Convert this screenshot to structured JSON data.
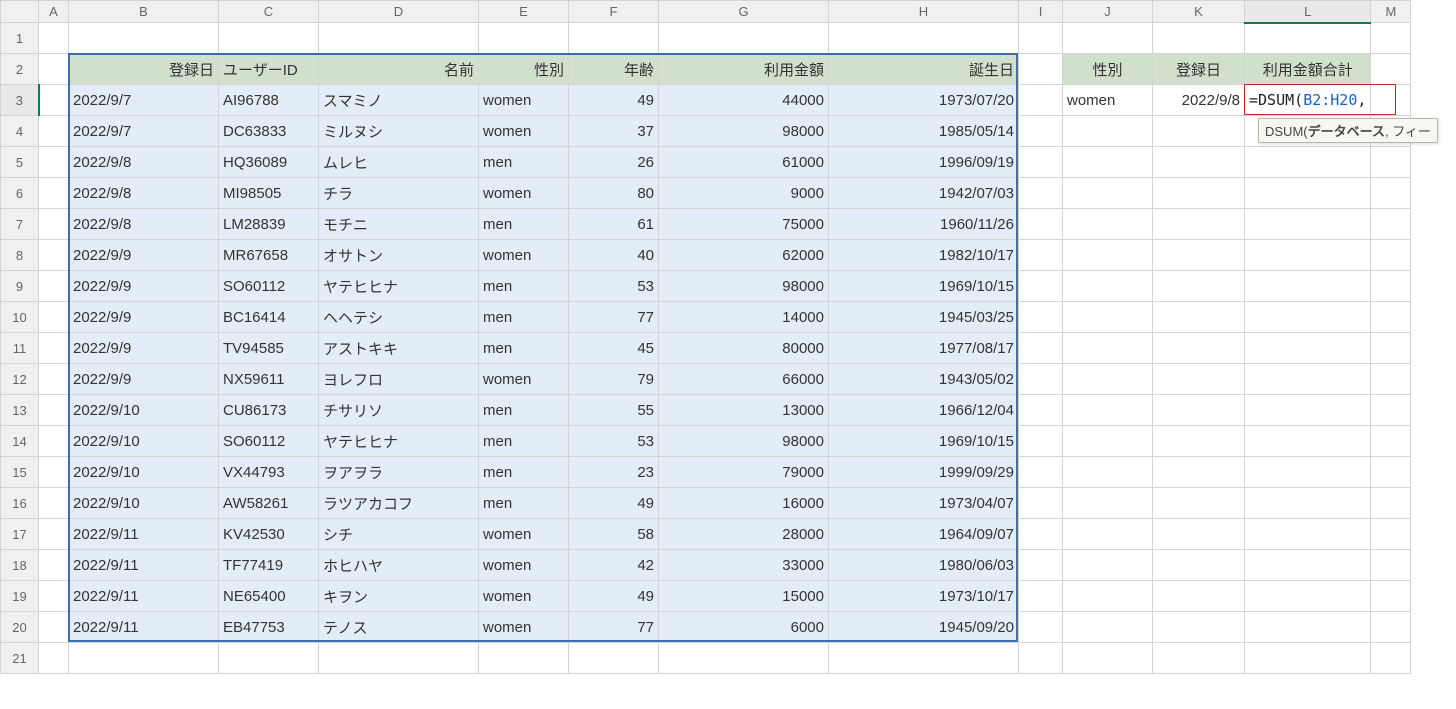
{
  "columns": [
    "A",
    "B",
    "C",
    "D",
    "E",
    "F",
    "G",
    "H",
    "I",
    "J",
    "K",
    "L",
    "M"
  ],
  "rowCount": 21,
  "headers_main": {
    "B": "登録日",
    "C": "ユーザーID",
    "D": "名前",
    "E": "性別",
    "F": "年齢",
    "G": "利用金額",
    "H": "誕生日"
  },
  "headers_side": {
    "J": "性別",
    "K": "登録日",
    "L": "利用金額合計"
  },
  "side_row3": {
    "J": "women",
    "K": "2022/9/8"
  },
  "formula": {
    "prefix": "=DSUM(",
    "range": "B2:H20",
    "suffix": ","
  },
  "tooltip": {
    "func": "DSUM(",
    "arg1_bold": "データベース",
    "rest": ", フィー"
  },
  "rows": [
    {
      "B": "2022/9/7",
      "C": "AI96788",
      "D": "スマミノ",
      "E": "women",
      "F": "49",
      "G": "44000",
      "H": "1973/07/20"
    },
    {
      "B": "2022/9/7",
      "C": "DC63833",
      "D": "ミルヌシ",
      "E": "women",
      "F": "37",
      "G": "98000",
      "H": "1985/05/14"
    },
    {
      "B": "2022/9/8",
      "C": "HQ36089",
      "D": "ムレヒ",
      "E": "men",
      "F": "26",
      "G": "61000",
      "H": "1996/09/19"
    },
    {
      "B": "2022/9/8",
      "C": "MI98505",
      "D": "チラ",
      "E": "women",
      "F": "80",
      "G": "9000",
      "H": "1942/07/03"
    },
    {
      "B": "2022/9/8",
      "C": "LM28839",
      "D": "モチニ",
      "E": "men",
      "F": "61",
      "G": "75000",
      "H": "1960/11/26"
    },
    {
      "B": "2022/9/9",
      "C": "MR67658",
      "D": "オサトン",
      "E": "women",
      "F": "40",
      "G": "62000",
      "H": "1982/10/17"
    },
    {
      "B": "2022/9/9",
      "C": "SO60112",
      "D": "ヤテヒヒナ",
      "E": "men",
      "F": "53",
      "G": "98000",
      "H": "1969/10/15"
    },
    {
      "B": "2022/9/9",
      "C": "BC16414",
      "D": "ヘヘテシ",
      "E": "men",
      "F": "77",
      "G": "14000",
      "H": "1945/03/25"
    },
    {
      "B": "2022/9/9",
      "C": "TV94585",
      "D": "アストキキ",
      "E": "men",
      "F": "45",
      "G": "80000",
      "H": "1977/08/17"
    },
    {
      "B": "2022/9/9",
      "C": "NX59611",
      "D": "ヨレフロ",
      "E": "women",
      "F": "79",
      "G": "66000",
      "H": "1943/05/02"
    },
    {
      "B": "2022/9/10",
      "C": "CU86173",
      "D": "チサリソ",
      "E": "men",
      "F": "55",
      "G": "13000",
      "H": "1966/12/04"
    },
    {
      "B": "2022/9/10",
      "C": "SO60112",
      "D": "ヤテヒヒナ",
      "E": "men",
      "F": "53",
      "G": "98000",
      "H": "1969/10/15"
    },
    {
      "B": "2022/9/10",
      "C": "VX44793",
      "D": "ヲアヲラ",
      "E": "men",
      "F": "23",
      "G": "79000",
      "H": "1999/09/29"
    },
    {
      "B": "2022/9/10",
      "C": "AW58261",
      "D": "ラツアカコフ",
      "E": "men",
      "F": "49",
      "G": "16000",
      "H": "1973/04/07"
    },
    {
      "B": "2022/9/11",
      "C": "KV42530",
      "D": "シチ",
      "E": "women",
      "F": "58",
      "G": "28000",
      "H": "1964/09/07"
    },
    {
      "B": "2022/9/11",
      "C": "TF77419",
      "D": "ホヒハヤ",
      "E": "women",
      "F": "42",
      "G": "33000",
      "H": "1980/06/03"
    },
    {
      "B": "2022/9/11",
      "C": "NE65400",
      "D": "キヲン",
      "E": "women",
      "F": "49",
      "G": "15000",
      "H": "1973/10/17"
    },
    {
      "B": "2022/9/11",
      "C": "EB47753",
      "D": "テノス",
      "E": "women",
      "F": "77",
      "G": "6000",
      "H": "1945/09/20"
    }
  ]
}
